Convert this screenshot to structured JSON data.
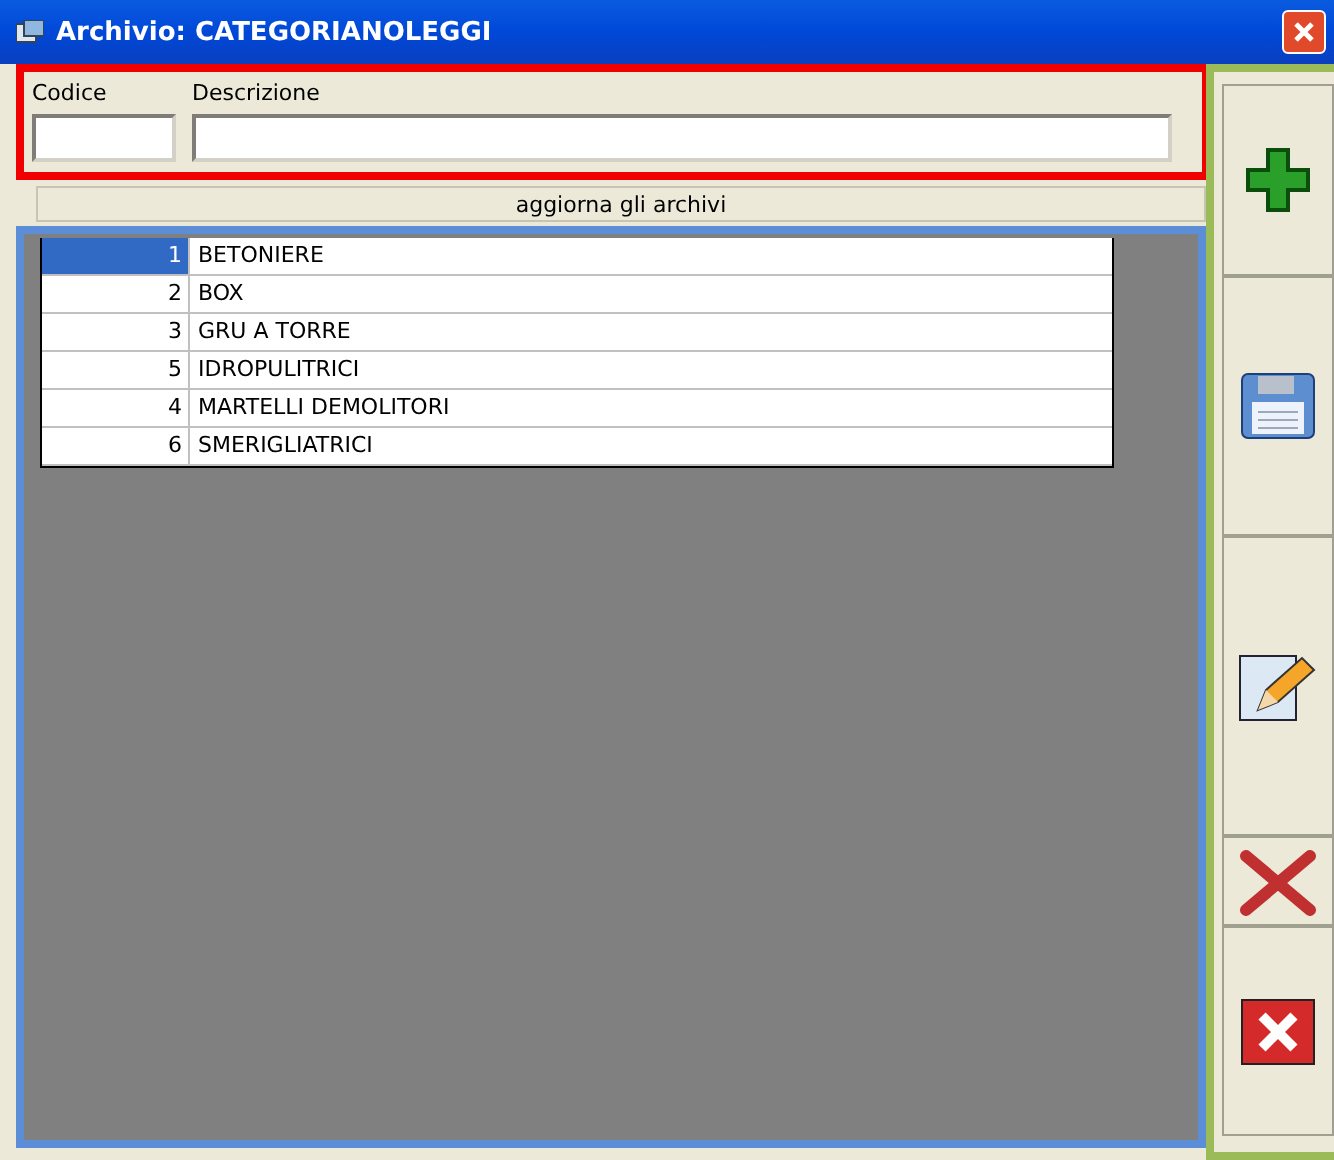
{
  "window": {
    "title": "Archivio: CATEGORIANOLEGGI"
  },
  "fields": [
    {
      "label": "Codice"
    },
    {
      "label": "Descrizione"
    }
  ],
  "refresh_button": "aggiorna gli archivi",
  "rows": [
    {
      "code": "1",
      "name": "BETONIERE",
      "selected": true
    },
    {
      "code": "2",
      "name": "BOX",
      "selected": false
    },
    {
      "code": "3",
      "name": "GRU A TORRE",
      "selected": false
    },
    {
      "code": "5",
      "name": "IDROPULITRICI",
      "selected": false
    },
    {
      "code": "4",
      "name": "MARTELLI DEMOLITORI",
      "selected": false
    },
    {
      "code": "6",
      "name": "SMERIGLIATRICI",
      "selected": false
    }
  ],
  "toolbar": [
    {
      "kind": "add"
    },
    {
      "kind": "save"
    },
    {
      "kind": "edit"
    },
    {
      "kind": "delete"
    },
    {
      "kind": "close"
    }
  ]
}
